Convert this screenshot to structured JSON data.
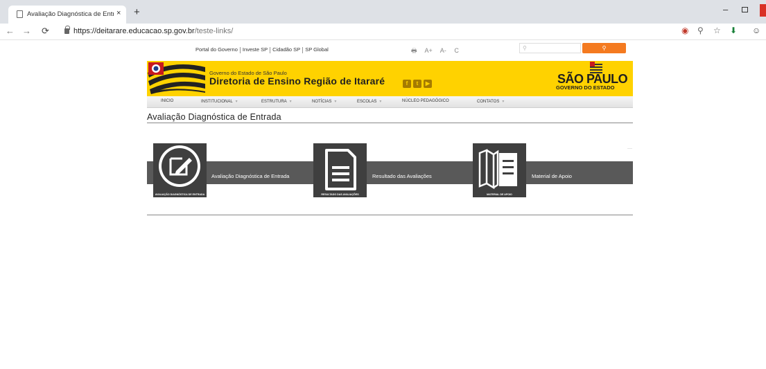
{
  "browser": {
    "tab_title": "Avaliação Diagnóstica de Entrada",
    "tab_close": "×",
    "new_tab": "+",
    "url_host": "https://deitarare.educacao.sp.gov.br",
    "url_path": "/teste-links/",
    "nav": {
      "back": "←",
      "forward": "→",
      "reload": "⟳"
    },
    "window": {
      "minimize": "–"
    },
    "toolbar_icons": [
      "shield-icon",
      "zoom-icon",
      "star-icon",
      "download-icon",
      "profile-icon"
    ],
    "toolbar_glyphs": {
      "zoom": "⚲",
      "star": "☆",
      "download": "⬇",
      "profile": "☺",
      "shield": "◉"
    }
  },
  "header": {
    "util_links": [
      "Portal do Governo",
      "Investe SP",
      "Cidadão SP",
      "SP Global"
    ],
    "accessibility": {
      "print": "🖶",
      "increase": "A+",
      "decrease": "A-",
      "contrast": "C"
    },
    "search": {
      "placeholder": "⚲",
      "button": "⚲"
    },
    "gov_small": "Governo do Estado de São Paulo",
    "gov_title": "Diretoria de Ensino Região de Itararé",
    "social": [
      "f",
      "t",
      "▶"
    ],
    "sp_logo": "SÃO PAULO",
    "sp_sub": "GOVERNO DO ESTADO"
  },
  "menu": [
    {
      "label": "INICIO",
      "chevron": false
    },
    {
      "label": "INSTITUCIONAL",
      "chevron": true
    },
    {
      "label": "ESTRUTURA",
      "chevron": true
    },
    {
      "label": "NOTÍCIAS",
      "chevron": true
    },
    {
      "label": "ESCOLAS",
      "chevron": true
    },
    {
      "label": "NÚCLEO PEDAGÓGICO",
      "chevron": false
    },
    {
      "label": "CONTATOS",
      "chevron": true
    }
  ],
  "menu_chevron": "▾",
  "main": {
    "page_title": "Avaliação Diagnóstica de Entrada",
    "links": [
      {
        "label": "Avaliação Diagnóstica de Entrada",
        "caption": "AVALIAÇÃO DIAGNÓSTICA DE ENTRADA",
        "icon": "pencil-note-icon"
      },
      {
        "label": "Resultado das Avaliações",
        "caption": "RESULTADO DAS AVALIAÇÕES",
        "icon": "document-icon"
      },
      {
        "label": "Material de Apoio",
        "caption": "MATERIAL DE APOIO",
        "icon": "open-book-icon"
      }
    ]
  },
  "colors": {
    "banner_yellow": "#ffd200",
    "search_orange": "#f47a20",
    "band_gray": "#595959",
    "thumb_dark": "#3f3f3f"
  }
}
